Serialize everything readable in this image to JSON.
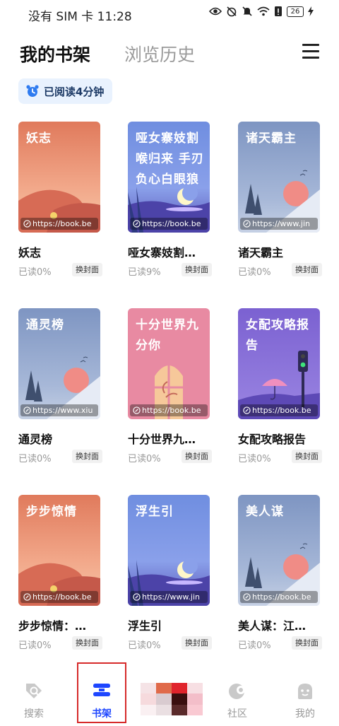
{
  "status_bar": {
    "carrier_time": "没有 SIM 卡 11:28",
    "battery_level": "26"
  },
  "header": {
    "tab_shelf": "我的书架",
    "tab_history": "浏览历史"
  },
  "reading_badge": {
    "label": "已阅读4分钟"
  },
  "books": [
    {
      "cover_title": "妖志",
      "title": "妖志",
      "progress": "已读0%",
      "url": "https://book.be",
      "cover_btn": "换封面",
      "style": "desert"
    },
    {
      "cover_title": "哑女寨妓割喉归来 手刃负心白眼狼",
      "title": "哑女寨妓割…",
      "progress": "已读9%",
      "url": "https://book.be",
      "cover_btn": "换封面",
      "style": "night"
    },
    {
      "cover_title": "诸天霸主",
      "title": "诸天霸主",
      "progress": "已读0%",
      "url": "https://www.jin",
      "cover_btn": "换封面",
      "style": "winter"
    },
    {
      "cover_title": "通灵榜",
      "title": "通灵榜",
      "progress": "已读0%",
      "url": "https://www.xiu",
      "cover_btn": "换封面",
      "style": "winter"
    },
    {
      "cover_title": "十分世界九分你",
      "title": "十分世界九…",
      "progress": "已读0%",
      "url": "https://book.be",
      "cover_btn": "换封面",
      "style": "window"
    },
    {
      "cover_title": "女配攻略报告",
      "title": "女配攻略报告",
      "progress": "已读0%",
      "url": "https://book.be",
      "cover_btn": "换封面",
      "style": "rain"
    },
    {
      "cover_title": "步步惊情",
      "title": "步步惊情：…",
      "progress": "已读0%",
      "url": "https://book.be",
      "cover_btn": "换封面",
      "style": "desert"
    },
    {
      "cover_title": "浮生引",
      "title": "浮生引",
      "progress": "已读0%",
      "url": "https://www.jin",
      "cover_btn": "换封面",
      "style": "night"
    },
    {
      "cover_title": "美人谋",
      "title": "美人谋：江…",
      "progress": "已读0%",
      "url": "https://book.be",
      "cover_btn": "换封面",
      "style": "winter"
    }
  ],
  "bottom_nav": {
    "search": "搜索",
    "bookshelf": "书架",
    "community": "社区",
    "mine": "我的",
    "active": "bookshelf"
  },
  "colors": {
    "accent": "#1e46ff",
    "highlight_box": "#d62a2a",
    "badge_bg": "#e9f2fe"
  },
  "ad_tiles": [
    "#f5e3e6",
    "#e06a4a",
    "#e0242c",
    "#f7dfe3",
    "#f6dadd",
    "#d9cbd0",
    "#3a0f0f",
    "#f3bec9",
    "#faf0f2",
    "#eadfe2",
    "#5a2a2a",
    "#f9c9d2"
  ]
}
